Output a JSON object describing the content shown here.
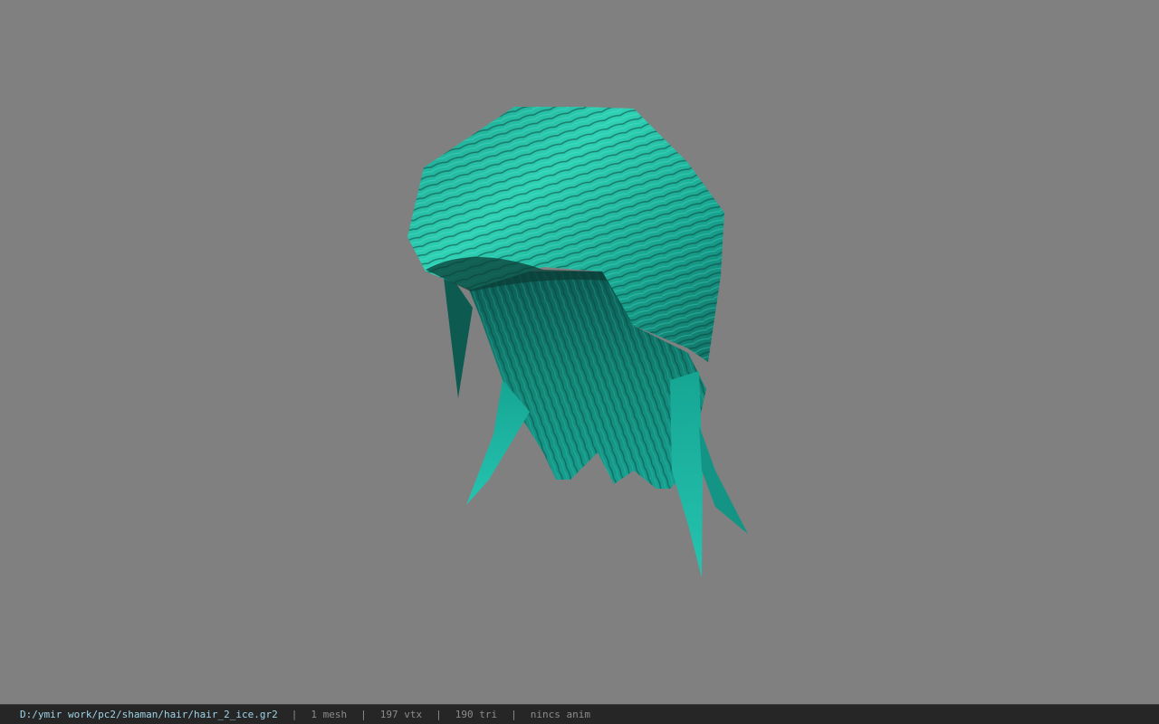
{
  "viewport": {
    "background": "#808080",
    "model": {
      "name": "hair-mesh",
      "color_dark": "#0b4a44",
      "color_mid": "#159a8a",
      "color_light": "#34e0c4"
    }
  },
  "statusbar": {
    "file_path": "D:/ymir work/pc2/shaman/hair/hair_2_ice.gr2",
    "separator": "|",
    "mesh_count": "1 mesh",
    "vertex_count": "197 vtx",
    "triangle_count": "190 tri",
    "anim_status": "nincs anim"
  }
}
